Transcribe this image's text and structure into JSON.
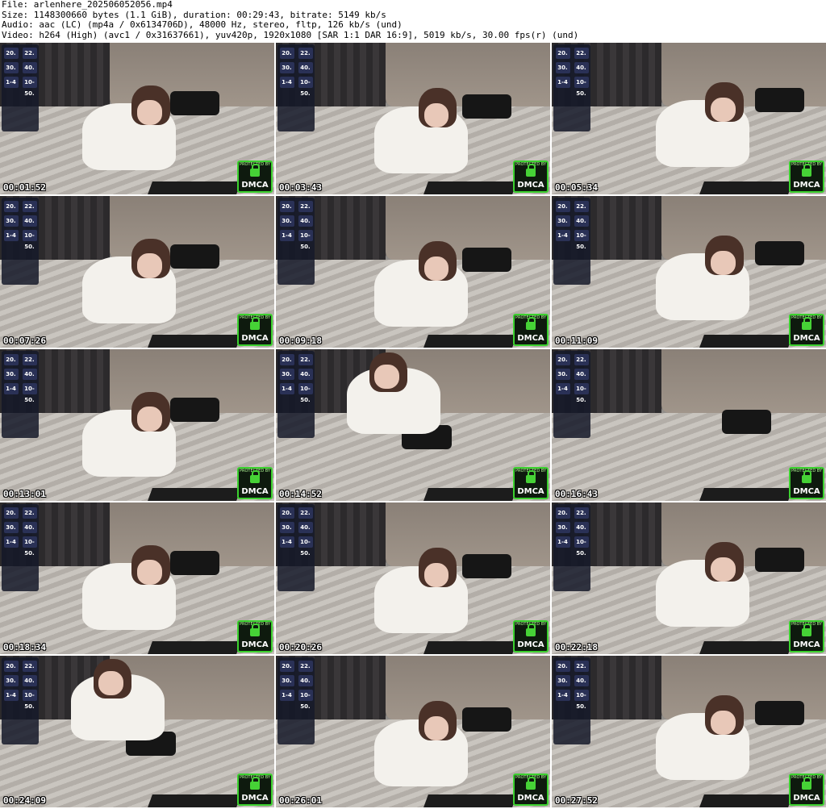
{
  "header": {
    "file_line": "File: arlenhere_202506052056.mp4",
    "size_line": "Size: 1148300660 bytes (1.1 GiB), duration: 00:29:43, bitrate: 5149 kb/s",
    "audio_line": "Audio: aac (LC) (mp4a / 0x6134706D), 48000 Hz, stereo, fltp, 126 kb/s (und)",
    "video_line": "Video: h264 (High) (avc1 / 0x31637661), yuv420p, 1920x1080 [SAR 1:1 DAR 16:9], 5019 kb/s, 30.00 fps(r) (und)"
  },
  "dmca_label": "DMCA",
  "protected_label": "PROTECTED BY",
  "overlay_values": [
    "20.",
    "22.",
    "30.",
    "40.",
    "1-4",
    "10-50."
  ],
  "thumbnails": [
    {
      "timestamp": "00:01:52",
      "pose": "a"
    },
    {
      "timestamp": "00:03:43",
      "pose": "b"
    },
    {
      "timestamp": "00:05:34",
      "pose": "c"
    },
    {
      "timestamp": "00:07:26",
      "pose": "a"
    },
    {
      "timestamp": "00:09:18",
      "pose": "b"
    },
    {
      "timestamp": "00:11:09",
      "pose": "c"
    },
    {
      "timestamp": "00:13:01",
      "pose": "a"
    },
    {
      "timestamp": "00:14:52",
      "pose": "sit"
    },
    {
      "timestamp": "00:16:43",
      "pose": "empty"
    },
    {
      "timestamp": "00:18:34",
      "pose": "a"
    },
    {
      "timestamp": "00:20:26",
      "pose": "b"
    },
    {
      "timestamp": "00:22:18",
      "pose": "c"
    },
    {
      "timestamp": "00:24:09",
      "pose": "sit"
    },
    {
      "timestamp": "00:26:01",
      "pose": "b"
    },
    {
      "timestamp": "00:27:52",
      "pose": "c"
    }
  ]
}
